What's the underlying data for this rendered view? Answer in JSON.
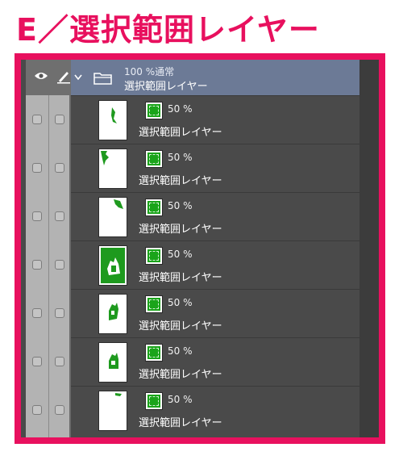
{
  "title": "E／選択範囲レイヤー",
  "colors": {
    "accent": "#e8105e",
    "header": "#6c7a96",
    "mask": "#1aa41a"
  },
  "header": {
    "eye_icon": "eye-icon",
    "pen_icon": "pen-icon",
    "folder_icon": "folder-icon",
    "opacity_blend": "100 %通常",
    "name": "選択範囲レイヤー"
  },
  "layers": [
    {
      "opacity": "50 %",
      "name": "選択範囲レイヤー"
    },
    {
      "opacity": "50 %",
      "name": "選択範囲レイヤー"
    },
    {
      "opacity": "50 %",
      "name": "選択範囲レイヤー"
    },
    {
      "opacity": "50 %",
      "name": "選択範囲レイヤー"
    },
    {
      "opacity": "50 %",
      "name": "選択範囲レイヤー"
    },
    {
      "opacity": "50 %",
      "name": "選択範囲レイヤー"
    },
    {
      "opacity": "50 %",
      "name": "選択範囲レイヤー"
    }
  ]
}
